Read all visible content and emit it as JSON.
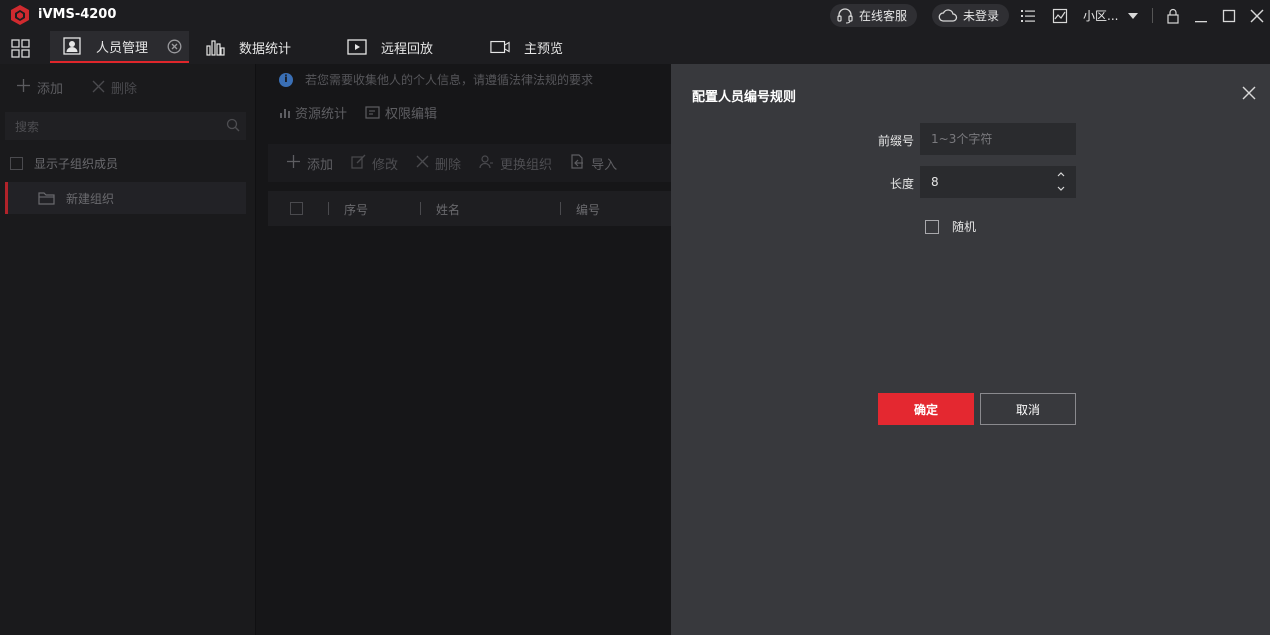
{
  "app": {
    "title": "iVMS-4200"
  },
  "titlebar": {
    "online_service": "在线客服",
    "not_logged_in": "未登录",
    "community": "小区..."
  },
  "tabs": [
    {
      "label": "人员管理",
      "active": true
    },
    {
      "label": "数据统计",
      "active": false
    },
    {
      "label": "远程回放",
      "active": false
    },
    {
      "label": "主预览",
      "active": false
    }
  ],
  "left_panel": {
    "add_label": "添加",
    "delete_label": "删除",
    "search_placeholder": "搜索",
    "show_sub_org_label": "显示子组织成员",
    "org_name": "新建组织"
  },
  "main": {
    "notice": "若您需要收集他人的个人信息，请遵循法律法规的要求",
    "subtabs": [
      "资源统计",
      "权限编辑"
    ],
    "toolbar": {
      "add": "添加",
      "modify": "修改",
      "delete": "删除",
      "change_org": "更换组织",
      "import": "导入"
    },
    "table_headers": [
      "序号",
      "姓名",
      "编号"
    ]
  },
  "dialog": {
    "title": "配置人员编号规则",
    "prefix_label": "前缀号",
    "prefix_placeholder": "1~3个字符",
    "length_label": "长度",
    "length_value": "8",
    "random_label": "随机",
    "ok_label": "确定",
    "cancel_label": "取消"
  },
  "colors": {
    "accent_red": "#e42830",
    "dialog_bg": "#38393d",
    "app_bg": "#161618"
  }
}
